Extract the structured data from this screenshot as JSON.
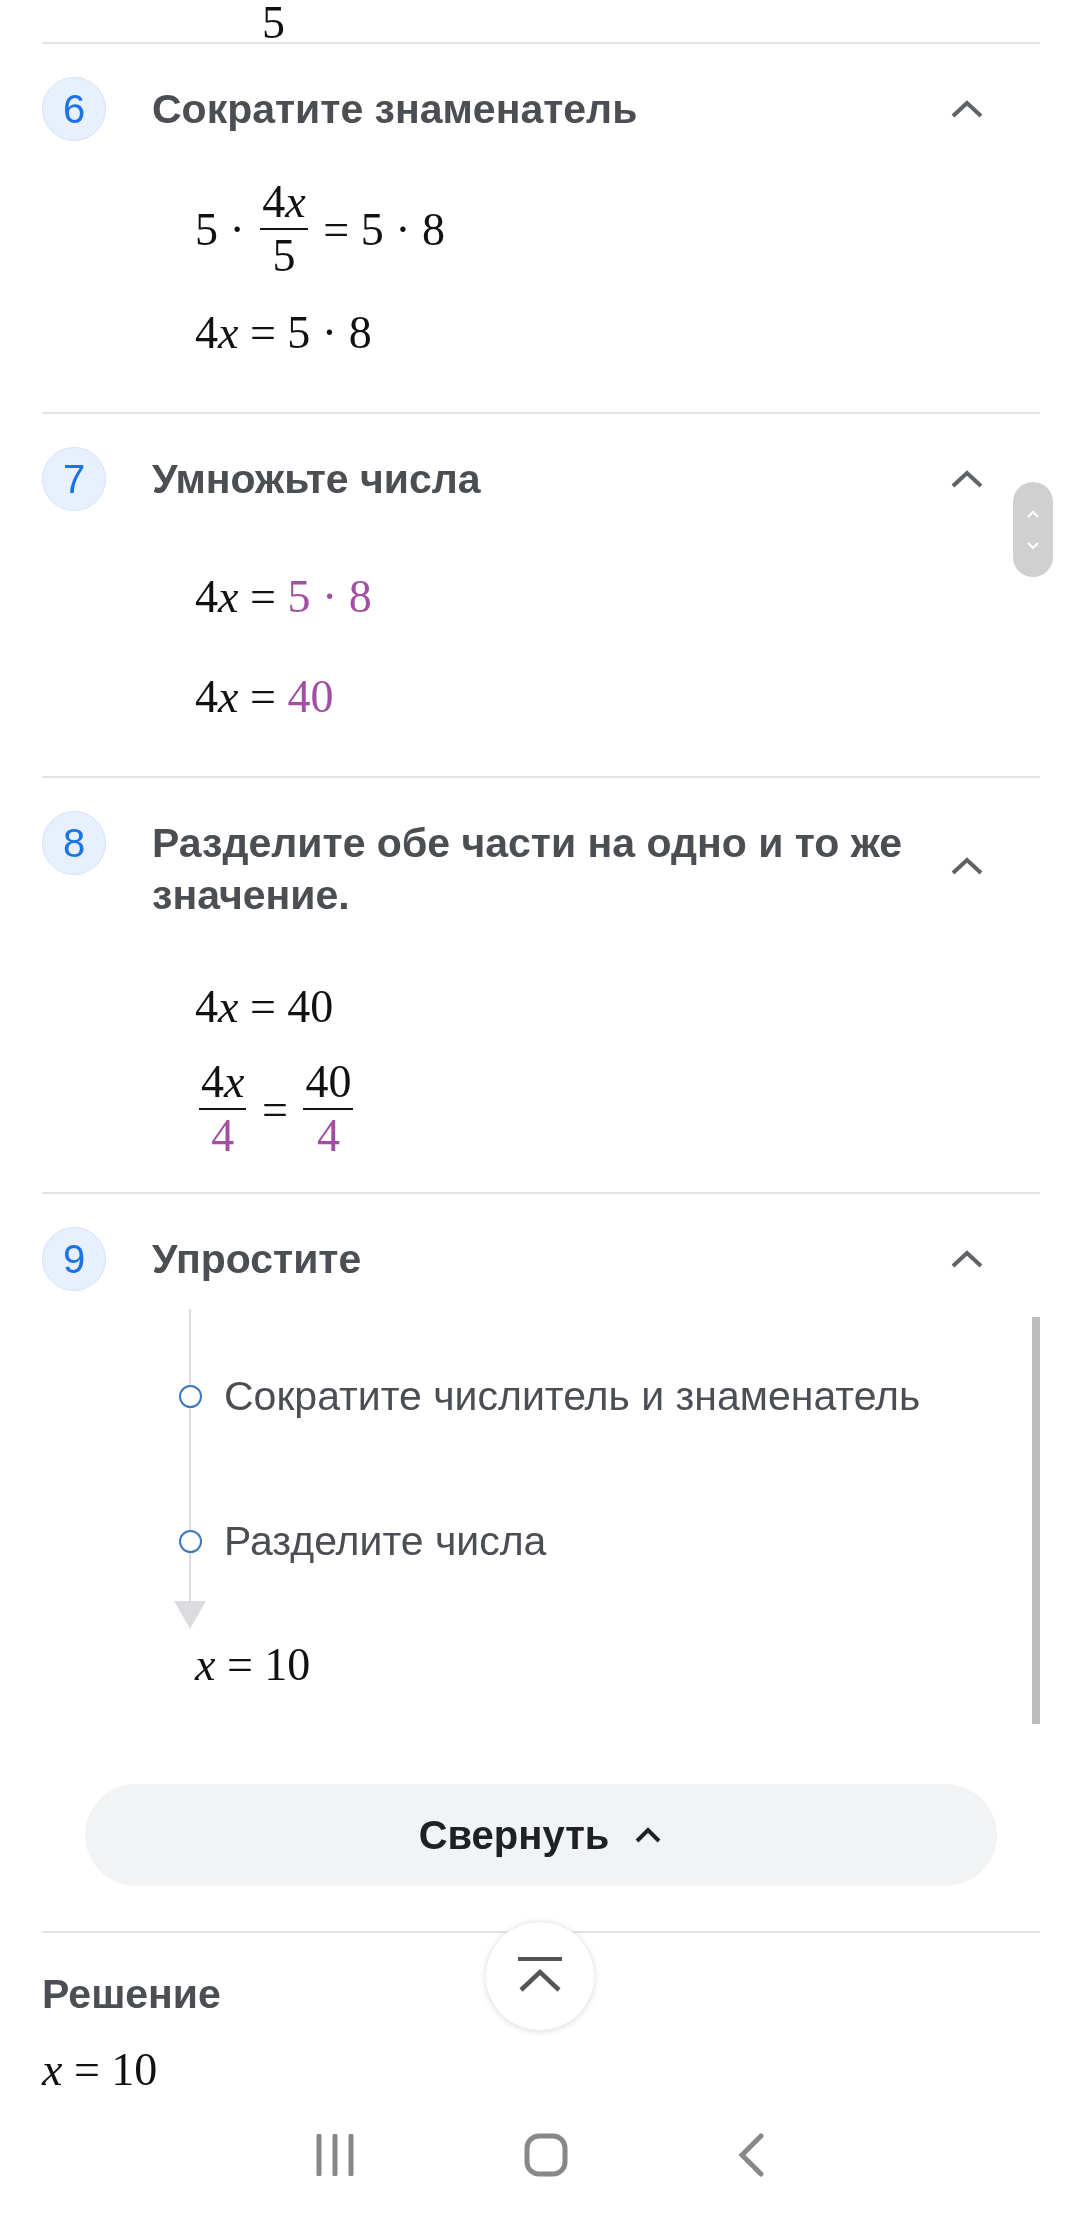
{
  "top_fragment": {
    "denominator": "5"
  },
  "steps": [
    {
      "number": "6",
      "title": "Сократите знаменатель",
      "expanded": true,
      "lines": [
        [
          {
            "kind": "text",
            "text": "5 · ",
            "highlight": false
          },
          {
            "kind": "frac",
            "num": [
              {
                "kind": "text",
                "text": "4",
                "highlight": false
              },
              {
                "kind": "var",
                "text": "x",
                "highlight": false
              }
            ],
            "den": [
              {
                "kind": "text",
                "text": "5",
                "highlight": false
              }
            ]
          },
          {
            "kind": "text",
            "text": " = 5 · 8",
            "highlight": false
          }
        ],
        [
          {
            "kind": "text",
            "text": "4",
            "highlight": false
          },
          {
            "kind": "var",
            "text": "x",
            "highlight": false
          },
          {
            "kind": "text",
            "text": " = 5 · 8",
            "highlight": false
          }
        ]
      ]
    },
    {
      "number": "7",
      "title": "Умножьте числа",
      "expanded": true,
      "lines": [
        [
          {
            "kind": "text",
            "text": "4",
            "highlight": false
          },
          {
            "kind": "var",
            "text": "x",
            "highlight": false
          },
          {
            "kind": "text",
            "text": " = ",
            "highlight": false
          },
          {
            "kind": "text",
            "text": "5 · 8",
            "highlight": true
          }
        ],
        [
          {
            "kind": "text",
            "text": "4",
            "highlight": false
          },
          {
            "kind": "var",
            "text": "x",
            "highlight": false
          },
          {
            "kind": "text",
            "text": " = ",
            "highlight": false
          },
          {
            "kind": "text",
            "text": "40",
            "highlight": true
          }
        ]
      ]
    },
    {
      "number": "8",
      "title": "Разделите обе части на одно и то же значение.",
      "expanded": true,
      "lines": [
        [
          {
            "kind": "text",
            "text": "4",
            "highlight": false
          },
          {
            "kind": "var",
            "text": "x",
            "highlight": false
          },
          {
            "kind": "text",
            "text": " = 40",
            "highlight": false
          }
        ],
        [
          {
            "kind": "frac",
            "num": [
              {
                "kind": "text",
                "text": "4",
                "highlight": false
              },
              {
                "kind": "var",
                "text": "x",
                "highlight": false
              }
            ],
            "den": [
              {
                "kind": "text",
                "text": "4",
                "highlight": true
              }
            ]
          },
          {
            "kind": "text",
            "text": " = ",
            "highlight": false
          },
          {
            "kind": "frac",
            "num": [
              {
                "kind": "text",
                "text": "40",
                "highlight": false
              }
            ],
            "den": [
              {
                "kind": "text",
                "text": "4",
                "highlight": true
              }
            ]
          }
        ]
      ]
    },
    {
      "number": "9",
      "title": "Упростите",
      "expanded": true,
      "substeps": [
        {
          "text": "Сократите числитель и знаменатель"
        },
        {
          "text": "Разделите числа"
        }
      ],
      "result": [
        {
          "kind": "var",
          "text": "x",
          "highlight": false
        },
        {
          "kind": "text",
          "text": " = 10",
          "highlight": false
        }
      ]
    }
  ],
  "collapse_button": {
    "label": "Свернуть"
  },
  "solution": {
    "title": "Решение",
    "result": [
      {
        "kind": "var",
        "text": "x"
      },
      {
        "kind": "text",
        "text": " = 10"
      }
    ]
  }
}
